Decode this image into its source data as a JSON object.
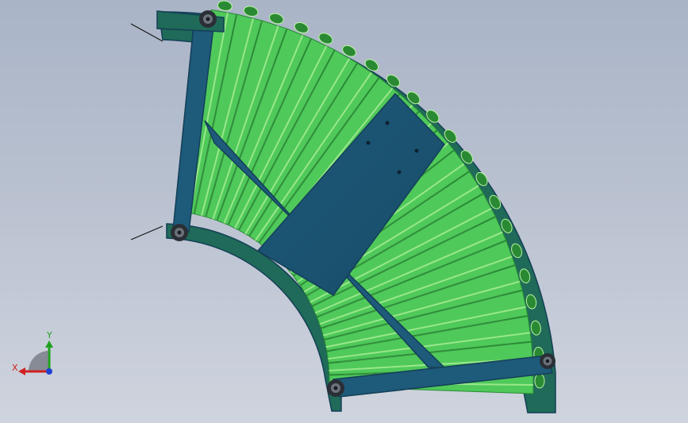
{
  "viewport": {
    "background_top": "#a9b4c7",
    "background_bottom": "#cfd4de",
    "model": {
      "frame_color": "#1e5a7a",
      "frame_edge_color": "#143f57",
      "rail_color": "#1f6a58",
      "roller_color": "#4fc95a",
      "roller_highlight": "#b9f5a0",
      "roller_shadow": "#2a8a34",
      "fastener_color": "#2a2f35",
      "inner_roller_count": 10,
      "outer_roller_count": 11
    }
  },
  "triad": {
    "x_label": "X",
    "y_label": "Y",
    "x_color": "#d02020",
    "y_color": "#20a020",
    "z_color": "#2040d0"
  }
}
